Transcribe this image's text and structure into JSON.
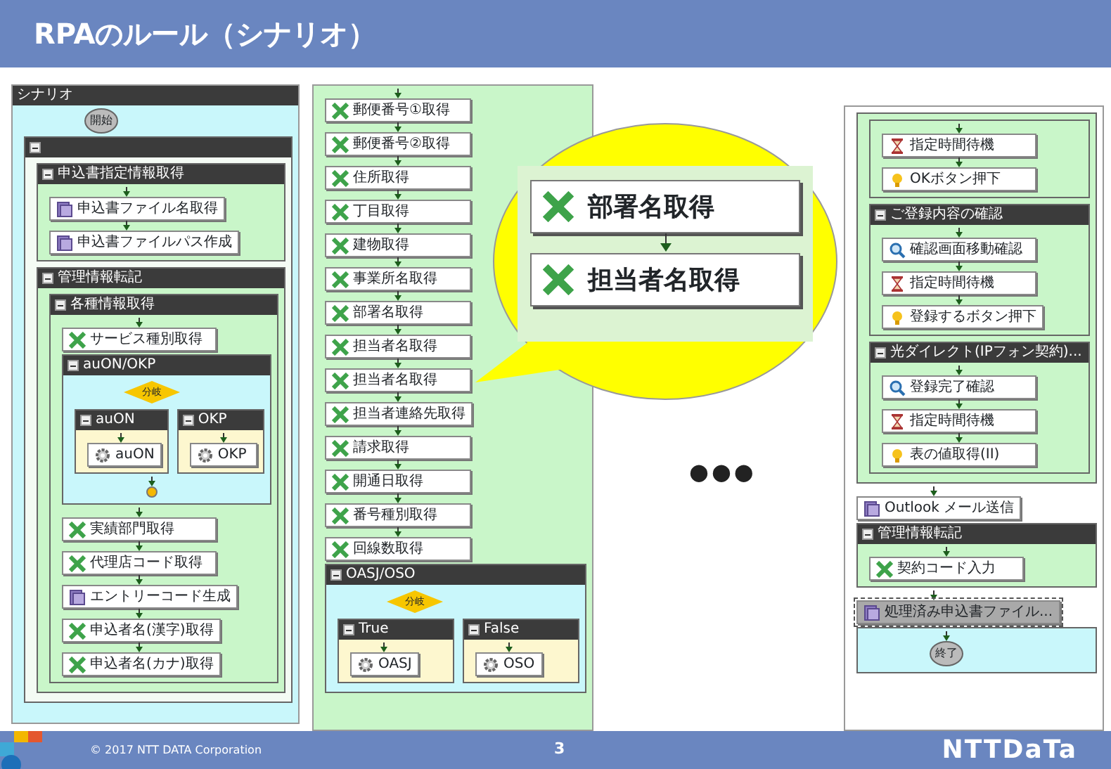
{
  "slide_title": "RPAのルール（シナリオ）",
  "panels": [
    {
      "title": "シナリオ",
      "color": "#c9f7fb",
      "items": [
        {
          "kind": "terminal",
          "text": "開始"
        },
        {
          "kind": "group",
          "header": true,
          "color": "#f4fbf4",
          "items": [
            {
              "kind": "group",
              "header": true,
              "title": "申込書指定情報取得",
              "color": "#c9f6c9",
              "items": [
                {
                  "kind": "script",
                  "text": "申込書ファイル名取得",
                  "selected": false
                },
                {
                  "kind": "script",
                  "text": "申込書ファイルパス作成",
                  "selected": false
                }
              ]
            },
            {
              "kind": "group",
              "header": true,
              "title": "管理情報転記",
              "color": "#c9f6c9",
              "items": [
                {
                  "kind": "group",
                  "header": true,
                  "title": "各種情報取得",
                  "items": [
                    {
                      "kind": "extract",
                      "text": "サービス種別取得",
                      "selected": false
                    },
                    {
                      "kind": "group",
                      "header": true,
                      "title": "auON/OKP",
                      "color": "#c9f7fb",
                      "items": [
                        {
                          "kind": "branch",
                          "text": "分岐",
                          "arms": [
                            {
                              "kind": "group",
                              "header": true,
                              "title": "auON",
                              "color": "#fdf7cf",
                              "items": [
                                {
                                  "kind": "program",
                                  "text": "auON",
                                  "selected": false
                                }
                              ]
                            },
                            {
                              "kind": "group",
                              "header": true,
                              "title": "OKP",
                              "color": "#fdf7cf",
                              "items": [
                                {
                                  "kind": "program",
                                  "text": "OKP",
                                  "selected": false
                                }
                              ]
                            }
                          ]
                        },
                        {
                          "kind": "merge"
                        }
                      ]
                    },
                    {
                      "kind": "extract",
                      "text": "実績部門取得",
                      "selected": false
                    },
                    {
                      "kind": "extract",
                      "text": "代理店コード取得",
                      "selected": false
                    },
                    {
                      "kind": "script",
                      "text": "エントリーコード生成",
                      "selected": false
                    },
                    {
                      "kind": "extract",
                      "text": "申込者名(漢字)取得",
                      "selected": false
                    },
                    {
                      "kind": "extract",
                      "text": "申込者名(カナ)取得",
                      "selected": false
                    }
                  ]
                }
              ]
            }
          ]
        }
      ]
    },
    {
      "color": "#c9f6c9",
      "items": [
        {
          "kind": "extract",
          "text": "郵便番号①取得",
          "selected": false
        },
        {
          "kind": "extract",
          "text": "郵便番号②取得",
          "selected": false
        },
        {
          "kind": "extract",
          "text": "住所取得",
          "selected": false
        },
        {
          "kind": "extract",
          "text": "丁目取得",
          "selected": false
        },
        {
          "kind": "extract",
          "text": "建物取得",
          "selected": false
        },
        {
          "kind": "extract",
          "text": "事業所名取得",
          "selected": false
        },
        {
          "kind": "extract",
          "text": "部署名取得",
          "selected": false
        },
        {
          "kind": "extract",
          "text": "担当者名取得",
          "selected": false
        },
        {
          "kind": "extract",
          "text": "担当者名取得",
          "selected": false
        },
        {
          "kind": "extract",
          "text": "担当者連絡先取得",
          "selected": false
        },
        {
          "kind": "extract",
          "text": "請求取得",
          "selected": false
        },
        {
          "kind": "extract",
          "text": "開通日取得",
          "selected": false
        },
        {
          "kind": "extract",
          "text": "番号種別取得",
          "selected": false
        },
        {
          "kind": "extract",
          "text": "回線数取得",
          "selected": false
        },
        {
          "kind": "group",
          "header": true,
          "title": "OASJ/OSO",
          "color": "#c9f7fb",
          "items": [
            {
              "kind": "branch",
              "text": "分岐",
              "arms": [
                {
                  "kind": "group",
                  "header": true,
                  "title": "True",
                  "color": "#fdf7cf",
                  "items": [
                    {
                      "kind": "program",
                      "text": "OASJ",
                      "selected": false
                    }
                  ]
                },
                {
                  "kind": "group",
                  "header": true,
                  "title": "False",
                  "color": "#fdf7cf",
                  "items": [
                    {
                      "kind": "program",
                      "text": "OSO",
                      "selected": false
                    }
                  ]
                }
              ]
            }
          ]
        }
      ]
    },
    {
      "color": "#ffffff",
      "items": [
        {
          "kind": "group",
          "header": false,
          "color": "#c9f6c9",
          "items": [
            {
              "kind": "group",
              "header": false,
              "items": [
                {
                  "kind": "wait",
                  "text": "指定時間待機",
                  "selected": false
                },
                {
                  "kind": "click",
                  "text": "OKボタン押下",
                  "selected": false
                }
              ]
            },
            {
              "kind": "group",
              "header": true,
              "title": "ご登録内容の確認",
              "color": "#c9f6c9",
              "items": [
                {
                  "kind": "check",
                  "text": "確認画面移動確認",
                  "selected": false
                },
                {
                  "kind": "wait",
                  "text": "指定時間待機",
                  "selected": false
                },
                {
                  "kind": "click",
                  "text": "登録するボタン押下",
                  "selected": false
                }
              ]
            },
            {
              "kind": "group",
              "header": true,
              "title": "光ダイレクト(IPフォン契約)...",
              "color": "#c9f6c9",
              "items": [
                {
                  "kind": "check",
                  "text": "登録完了確認",
                  "selected": false
                },
                {
                  "kind": "wait",
                  "text": "指定時間待機",
                  "selected": false
                },
                {
                  "kind": "click",
                  "text": "表の値取得(II)",
                  "selected": false
                }
              ]
            }
          ]
        },
        {
          "kind": "mail",
          "text": "Outlook メール送信",
          "selected": false
        },
        {
          "kind": "group",
          "header": true,
          "title": "管理情報転記",
          "color": "#c9f6c9",
          "items": [
            {
              "kind": "extract",
              "text": "契約コード入力",
              "selected": false
            }
          ]
        },
        {
          "kind": "mail",
          "text": "処理済み申込書ファイル...",
          "selected": true
        },
        {
          "kind": "group",
          "header": false,
          "color": "#c9f7fb",
          "items": [
            {
              "kind": "terminal",
              "text": "終了"
            }
          ]
        }
      ]
    }
  ],
  "callout": {
    "nodes": [
      {
        "kind": "extract",
        "text": "部署名取得"
      },
      {
        "kind": "extract",
        "text": "担当者名取得"
      }
    ]
  },
  "ellipsis": "●●●",
  "footer": {
    "copyright": "© 2017 NTT DATA Corporation",
    "page": "3",
    "logo": "NTTDaTa"
  }
}
